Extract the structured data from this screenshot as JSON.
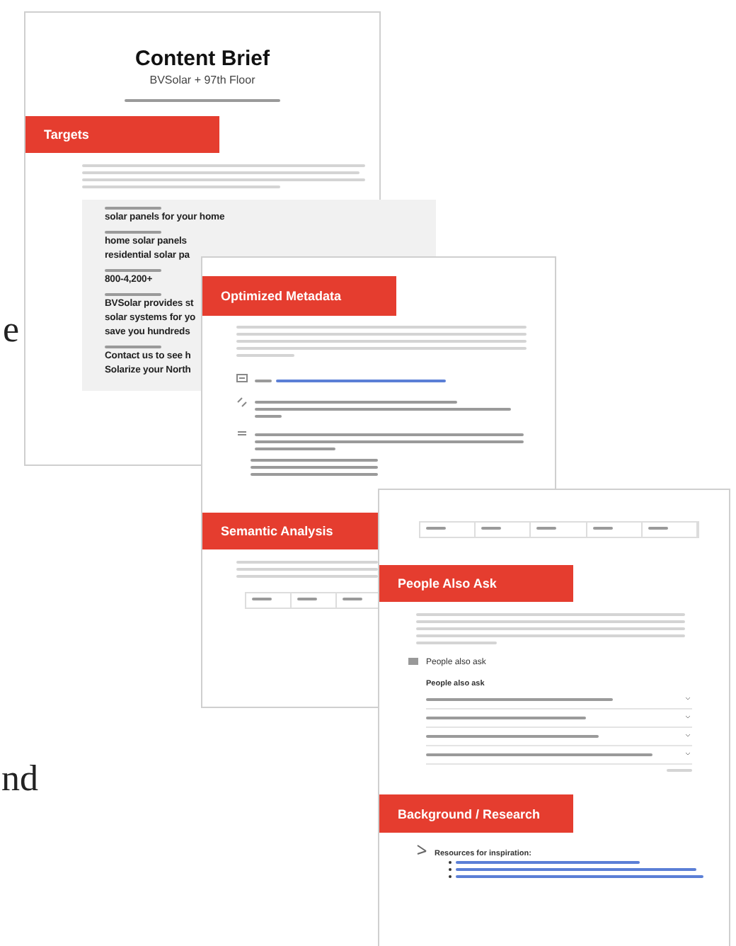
{
  "side_text": [
    "e",
    "nd"
  ],
  "brief_page": {
    "title": "Content Brief",
    "subtitle": "BVSolar + 97th Floor",
    "section": "Targets",
    "fields": [
      {
        "lines": [
          "solar panels for your home"
        ]
      },
      {
        "lines": [
          "home solar panels",
          "residential solar pa"
        ]
      },
      {
        "lines": [
          "800-4,200+"
        ]
      },
      {
        "lines": [
          "BVSolar provides st",
          "solar systems for yo",
          "save you hundreds"
        ]
      },
      {
        "lines": [
          "Contact us to see h",
          "Solarize your North"
        ]
      }
    ]
  },
  "metadata_page": {
    "section": "Optimized Metadata",
    "section_2": "Semantic Analysis"
  },
  "paa_page": {
    "section": "People Also Ask",
    "widget_title": "People also ask",
    "widget_heading": "People also ask",
    "section_2": "Background / Research",
    "resources_heading": "Resources for inspiration:"
  }
}
